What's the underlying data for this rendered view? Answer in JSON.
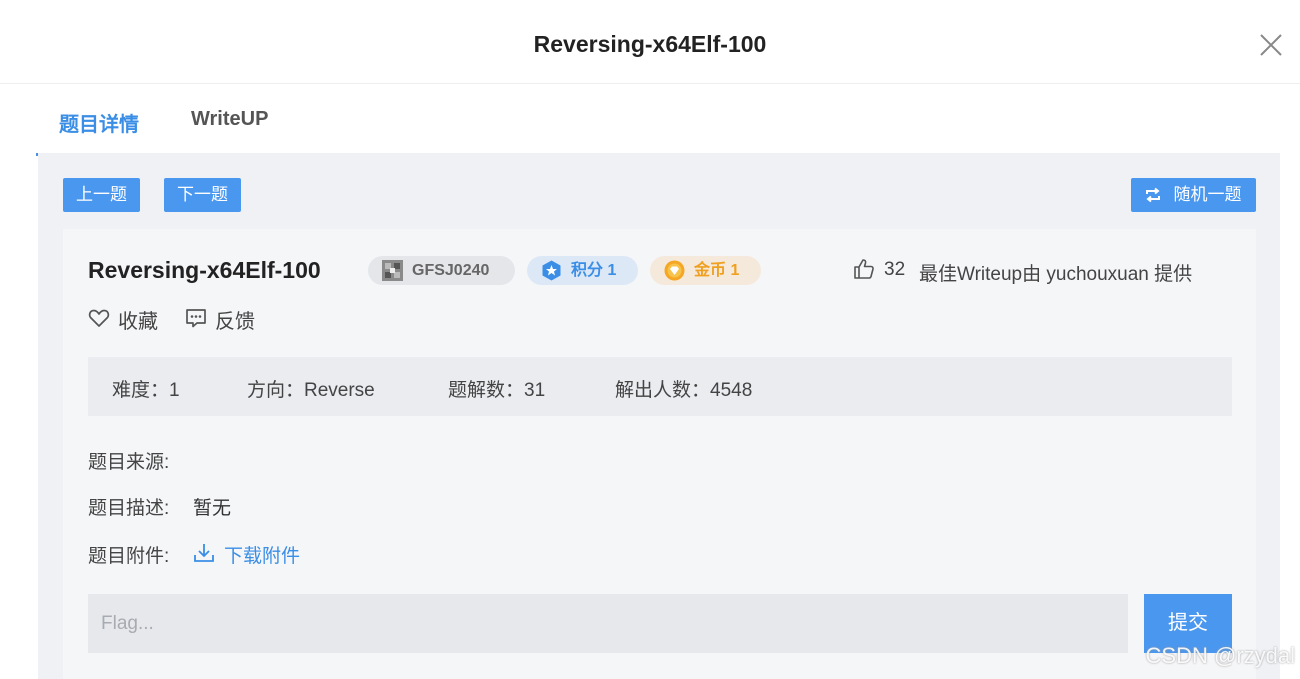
{
  "modal": {
    "title": "Reversing-x64Elf-100"
  },
  "tabs": [
    {
      "label": "题目详情",
      "active": true
    },
    {
      "label": "WriteUP",
      "active": false
    }
  ],
  "nav": {
    "prev_label": "上一题",
    "next_label": "下一题",
    "random_label": "随机一题"
  },
  "challenge": {
    "title": "Reversing-x64Elf-100",
    "author_tag": "GFSJ0240",
    "points_tag": "积分 1",
    "coins_tag": "金币 1",
    "likes": "32",
    "writeup_credit": "最佳Writeup由 yuchouxuan 提供",
    "favorite_label": "收藏",
    "feedback_label": "反馈"
  },
  "stats": {
    "difficulty": "难度：1",
    "direction": "方向：Reverse",
    "solutions": "题解数：31",
    "solvers": "解出人数：4548"
  },
  "fields": {
    "source_label": "题目来源:",
    "description_label": "题目描述:",
    "description_value": "暂无",
    "attachment_label": "题目附件:",
    "download_label": "下载附件"
  },
  "flag": {
    "placeholder": "Flag...",
    "value": "",
    "submit_label": "提交"
  },
  "watermark": "CSDN @rzydal",
  "colors": {
    "accent": "#4a97f0",
    "coin": "#f0a020",
    "panel_bg": "#eff1f5"
  }
}
